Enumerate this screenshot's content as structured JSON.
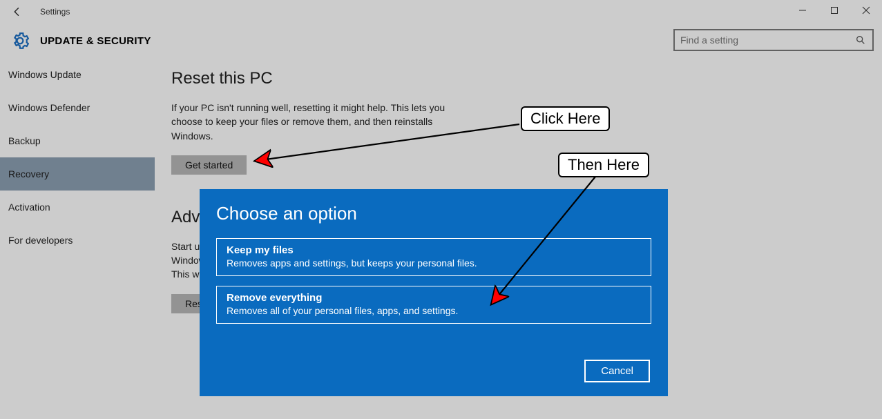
{
  "window": {
    "title": "Settings",
    "section": "UPDATE & SECURITY",
    "search_placeholder": "Find a setting"
  },
  "sidebar": {
    "items": [
      {
        "label": "Windows Update"
      },
      {
        "label": "Windows Defender"
      },
      {
        "label": "Backup"
      },
      {
        "label": "Recovery"
      },
      {
        "label": "Activation"
      },
      {
        "label": "For developers"
      }
    ],
    "selected_index": 3
  },
  "main": {
    "reset": {
      "heading": "Reset this PC",
      "body": "If your PC isn't running well, resetting it might help. This lets you choose to keep your files or remove them, and then reinstalls Windows.",
      "button": "Get started"
    },
    "advanced": {
      "heading": "Advanced startup",
      "body_visible": "Start up from a device or disc (such as a USB drive or DVD), change Windows startup settings, or restore Windows from a system image. This will restart your PC.",
      "button_visible": "Restart now"
    }
  },
  "dialog": {
    "title": "Choose an option",
    "options": [
      {
        "title": "Keep my files",
        "desc": "Removes apps and settings, but keeps your personal files."
      },
      {
        "title": "Remove everything",
        "desc": "Removes all of your personal files, apps, and settings."
      }
    ],
    "cancel": "Cancel"
  },
  "annotations": {
    "first": "Click Here",
    "second": "Then Here"
  }
}
